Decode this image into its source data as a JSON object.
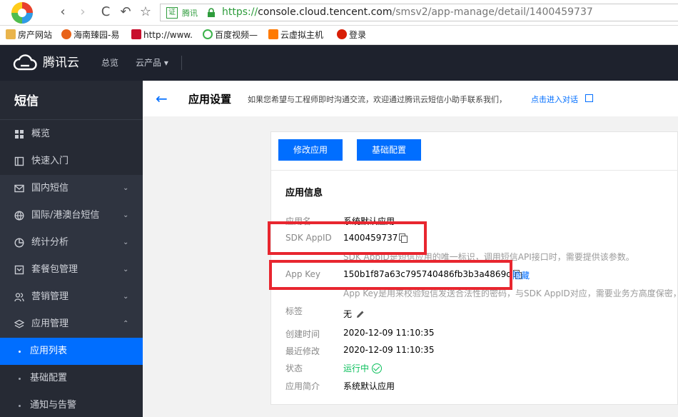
{
  "browser": {
    "back": "‹",
    "forward": "›",
    "refresh": "C",
    "undo": "↶",
    "star": "☆",
    "cert_label": "证",
    "cert_name": "腾讯",
    "url_scheme": "https://",
    "url_host": "console.cloud.tencent.com",
    "url_path": "/smsv2/app-manage/detail/1400459737"
  },
  "bookmarks": [
    {
      "label": "房产网站",
      "color": "#e9b44c"
    },
    {
      "label": "海南臻园-易",
      "color": "#e8631a"
    },
    {
      "label": "http://www.",
      "color": "#c8102e"
    },
    {
      "label": "百度视频—",
      "color": "#3bb24a"
    },
    {
      "label": "云虚拟主机",
      "color": "#ff7a00"
    },
    {
      "label": "登录",
      "color": "#d81e06"
    }
  ],
  "topnav": {
    "brand": "腾讯云",
    "overview": "总览",
    "products": "云产品 ▾"
  },
  "sidebar": {
    "title": "短信",
    "items": [
      {
        "label": "概览"
      },
      {
        "label": "快速入门"
      },
      {
        "label": "国内短信",
        "chev": "⌄"
      },
      {
        "label": "国际/港澳台短信",
        "chev": "⌄"
      },
      {
        "label": "统计分析",
        "chev": "⌄"
      },
      {
        "label": "套餐包管理",
        "chev": "⌄"
      },
      {
        "label": "营销管理",
        "chev": "⌄"
      },
      {
        "label": "应用管理",
        "chev": "⌃"
      },
      {
        "label": "应用列表"
      },
      {
        "label": "基础配置"
      },
      {
        "label": "通知与告警"
      }
    ]
  },
  "header": {
    "back": "←",
    "title": "应用设置",
    "hint": "如果您希望与工程师即时沟通交流，欢迎通过腾讯云短信小助手联系我们，",
    "hint_link": "点击进入对话"
  },
  "card": {
    "edit_button": "修改应用",
    "config_button": "基础配置",
    "section_title": "应用信息",
    "app_name_label": "应用名",
    "app_name_value": "系统默认应用",
    "sdk_appid_label": "SDK AppID",
    "sdk_appid_value": "1400459737",
    "sdk_appid_desc": "SDK AppID是短信应用的唯一标识，调用短信API接口时，需要提供该参数。",
    "appkey_label": "App Key",
    "appkey_value": "150b1f87a63c795740486fb3b3a4869d",
    "appkey_action": "隐藏",
    "appkey_desc": "App Key是用来校验短信发送合法性的密码，与SDK AppID对应，需要业务方高度保密，切",
    "tag_label": "标签",
    "tag_value": "无",
    "created_label": "创建时间",
    "created_value": "2020-12-09 11:10:35",
    "modified_label": "最近修改",
    "modified_value": "2020-12-09 11:10:35",
    "status_label": "状态",
    "status_value": "运行中",
    "intro_label": "应用简介",
    "intro_value": "系统默认应用"
  }
}
